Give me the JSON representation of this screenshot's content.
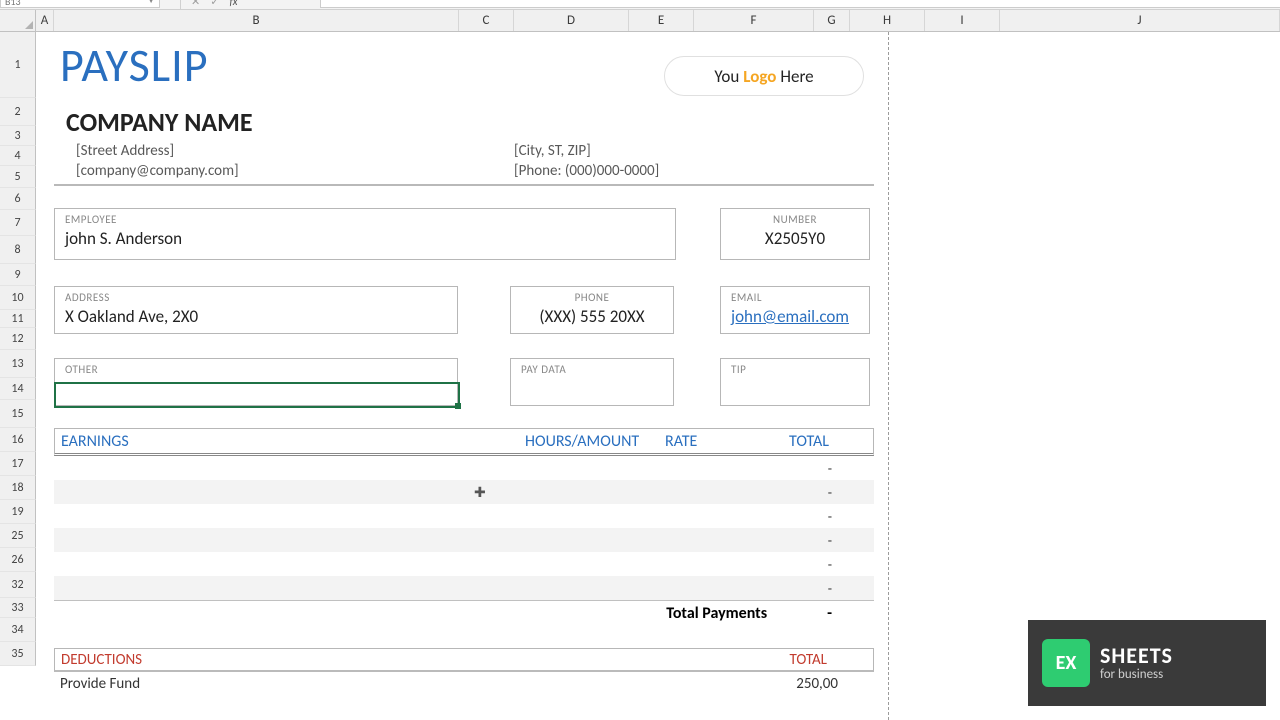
{
  "namebox": {
    "ref": "B13"
  },
  "columns": [
    "A",
    "B",
    "C",
    "D",
    "E",
    "F",
    "G",
    "H",
    "I",
    "J"
  ],
  "rows": [
    "1",
    "2",
    "3",
    "4",
    "5",
    "6",
    "7",
    "8",
    "9",
    "10",
    "11",
    "12",
    "13",
    "14",
    "15",
    "16",
    "17",
    "18",
    "19",
    "25",
    "26",
    "32",
    "33",
    "34",
    "35"
  ],
  "doc": {
    "title": "PAYSLIP",
    "logoText": {
      "pre": "You ",
      "mid": "Logo",
      "post": " Here"
    },
    "company": "COMPANY NAME",
    "street": "[Street Address]",
    "cityzip": "[City, ST, ZIP]",
    "email": "[company@company.com]",
    "phone": "[Phone: (000)000-0000]",
    "fields": {
      "employee_lbl": "EMPLOYEE",
      "employee_val": "john S. Anderson",
      "number_lbl": "NUMBER",
      "number_val": "X2505Y0",
      "address_lbl": "ADDRESS",
      "address_val": "X Oakland Ave, 2X0",
      "phone_lbl": "PHONE",
      "phone_val": "(XXX) 555 20XX",
      "email_lbl": "EMAIL",
      "email_val": "john@email.com",
      "other_lbl": "OTHER",
      "other_val": "",
      "paydata_lbl": "PAY DATA",
      "paydata_val": "",
      "tip_lbl": "TIP",
      "tip_val": ""
    },
    "earnings": {
      "header": {
        "earnings": "EARNINGS",
        "hours": "HOURS/AMOUNT",
        "rate": "RATE",
        "total": "TOTAL"
      },
      "rows": [
        "-",
        "-",
        "-",
        "-",
        "-",
        "-"
      ],
      "totalLabel": "Total Payments",
      "totalValue": "-"
    },
    "deductions": {
      "header": {
        "label": "DEDUCTIONS",
        "total": "TOTAL"
      },
      "rows": [
        {
          "name": "Provide Fund",
          "value": "250,00"
        }
      ]
    }
  },
  "brand": {
    "icon": "EX",
    "line1": "SHEETS",
    "line2": "for business"
  }
}
